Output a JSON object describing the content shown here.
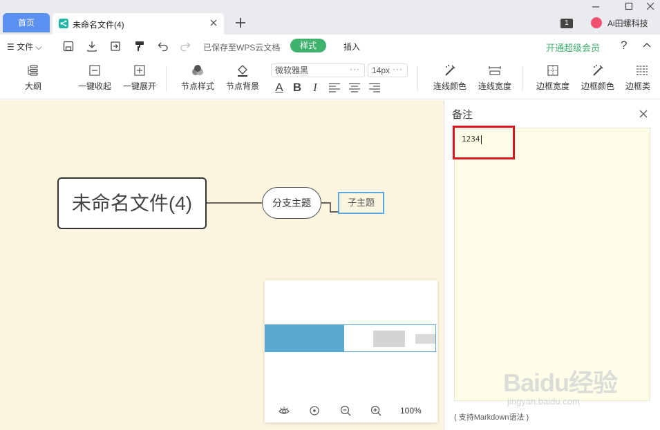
{
  "tabs": {
    "home": "首页",
    "doc": "未命名文件(4)"
  },
  "titlebar": {
    "badge": "1",
    "user": "Ai田螺科技"
  },
  "menu": {
    "file": "☰ 文件 ⌵",
    "saved": "已保存至WPS云文档",
    "style_tab": "样式",
    "insert_tab": "插入",
    "vip": "开通超级会员",
    "help": "?"
  },
  "toolbar": {
    "outline": "大纲",
    "collapse_all": "一键收起",
    "expand_all": "一键展开",
    "node_style": "节点样式",
    "node_bg": "节点背景",
    "font_family": "微软雅黑",
    "font_size": "14px",
    "font_color": "A",
    "bold": "B",
    "italic": "I",
    "line_color": "连线颜色",
    "line_width": "连线宽度",
    "border_width": "边框宽度",
    "border_color": "边框颜色",
    "border_type": "边框类"
  },
  "mindmap": {
    "root": "未命名文件(4)",
    "branch": "分支主题",
    "sub": "子主题"
  },
  "minimap": {
    "zoom": "100%"
  },
  "notes": {
    "title": "备注",
    "content": "1234",
    "hint": "( 支持Markdown语法 )"
  },
  "watermark": {
    "main": "Baidu经验",
    "sub": "jingyan.baidu.com"
  },
  "colors": {
    "accent_green": "#3fb36e",
    "tab_blue": "#5b8ff0",
    "canvas_bg": "#fcf5df",
    "highlight_red": "#d9151f",
    "selection_blue": "#5aa7e0"
  }
}
